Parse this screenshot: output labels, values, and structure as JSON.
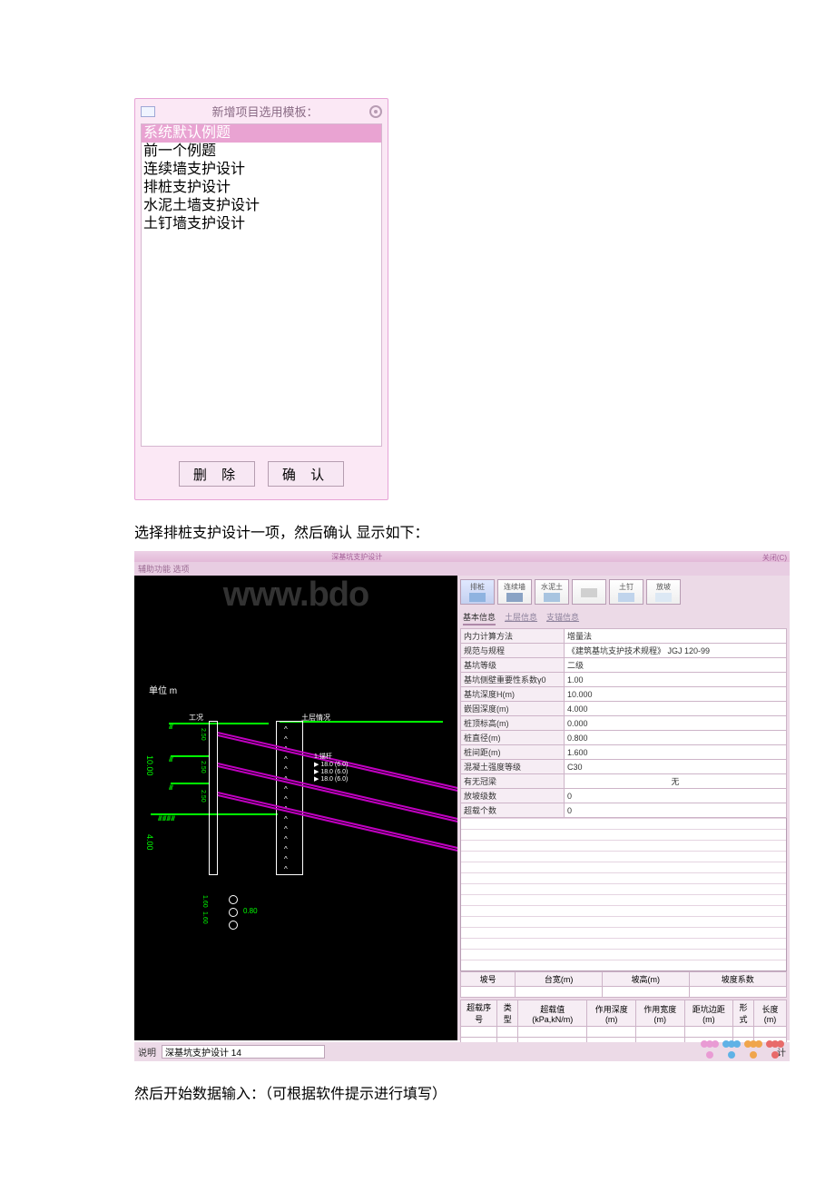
{
  "dialog": {
    "title": "新增项目选用模板：",
    "items": [
      "系统默认例题",
      "前一个例题",
      "连续墙支护设计",
      "排桩支护设计",
      "水泥土墙支护设计",
      "土钉墙支护设计"
    ],
    "selected_index": 0,
    "btn_delete": "删 除",
    "btn_ok": "确 认"
  },
  "para1": "选择排桩支护设计一项，然后确认 显示如下：",
  "para2": "然后开始数据输入：（可根据软件提示进行填写）",
  "app": {
    "titlebar": "深基坑支护设计",
    "close_label": "关闭(C)",
    "menu": "辅助功能  选项",
    "watermark": "www.bdo",
    "unit_label": "单位  m",
    "top_label_left": "工况",
    "top_label_right": "土层情况",
    "dim_total": "10.00",
    "dim_embed": "4.00",
    "small_dims": [
      "2.50",
      "2.50",
      "2.50"
    ],
    "toolbar": [
      {
        "label": "排桩",
        "active": true
      },
      {
        "label": "连续墙",
        "active": false
      },
      {
        "label": "水泥土",
        "active": false
      },
      {
        "label": "",
        "active": false
      },
      {
        "label": "土钉",
        "active": false
      },
      {
        "label": "放坡",
        "active": false
      }
    ],
    "tabs": [
      "基本信息",
      "土层信息",
      "支锚信息"
    ],
    "active_tab": 0,
    "info_rows": [
      {
        "k": "内力计算方法",
        "v": "增量法"
      },
      {
        "k": "规范与规程",
        "v": "《建筑基坑支护技术规程》 JGJ 120-99"
      },
      {
        "k": "基坑等级",
        "v": "二级"
      },
      {
        "k": "基坑侧壁重要性系数γ0",
        "v": "1.00"
      },
      {
        "k": "基坑深度H(m)",
        "v": "10.000"
      },
      {
        "k": "嵌固深度(m)",
        "v": "4.000"
      },
      {
        "k": "桩顶标高(m)",
        "v": "0.000"
      },
      {
        "k": "桩直径(m)",
        "v": "0.800"
      },
      {
        "k": "桩间距(m)",
        "v": "1.600"
      },
      {
        "k": "混凝土强度等级",
        "v": "C30"
      },
      {
        "k": "有无冠梁",
        "v": "无"
      },
      {
        "k": "放坡级数",
        "v": "0"
      },
      {
        "k": "超载个数",
        "v": "0"
      }
    ],
    "slope_headers": [
      "坡号",
      "台宽(m)",
      "坡高(m)",
      "坡度系数"
    ],
    "load_headers": [
      "超载序号",
      "类型",
      "超载值(kPa,kN/m)",
      "作用深度(m)",
      "作用宽度(m)",
      "距坑边距(m)",
      "形式",
      "长度(m)"
    ],
    "status_label": "说明",
    "status_value": "深基坑支护设计 14",
    "calc_btn": "计"
  }
}
